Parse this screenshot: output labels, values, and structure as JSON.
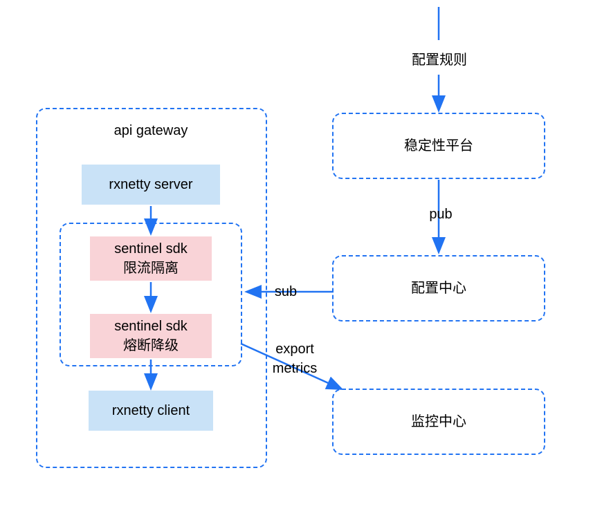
{
  "colors": {
    "stroke": "#2173f2",
    "blueFill": "#c9e2f7",
    "pinkFill": "#f9d3d7"
  },
  "gateway": {
    "title": "api gateway",
    "rxnetty_server": "rxnetty server",
    "inner": {
      "sentinel_rate_limit_line1": "sentinel sdk",
      "sentinel_rate_limit_line2": "限流隔离",
      "sentinel_circuit_line1": "sentinel sdk",
      "sentinel_circuit_line2": "熔断降级"
    },
    "rxnetty_client": "rxnetty client"
  },
  "right": {
    "config_rule": "配置规则",
    "stability_platform": "稳定性平台",
    "pub": "pub",
    "config_center": "配置中心",
    "sub": "sub",
    "export_metrics_line1": "export",
    "export_metrics_line2": "metrics",
    "monitor_center": "监控中心"
  }
}
